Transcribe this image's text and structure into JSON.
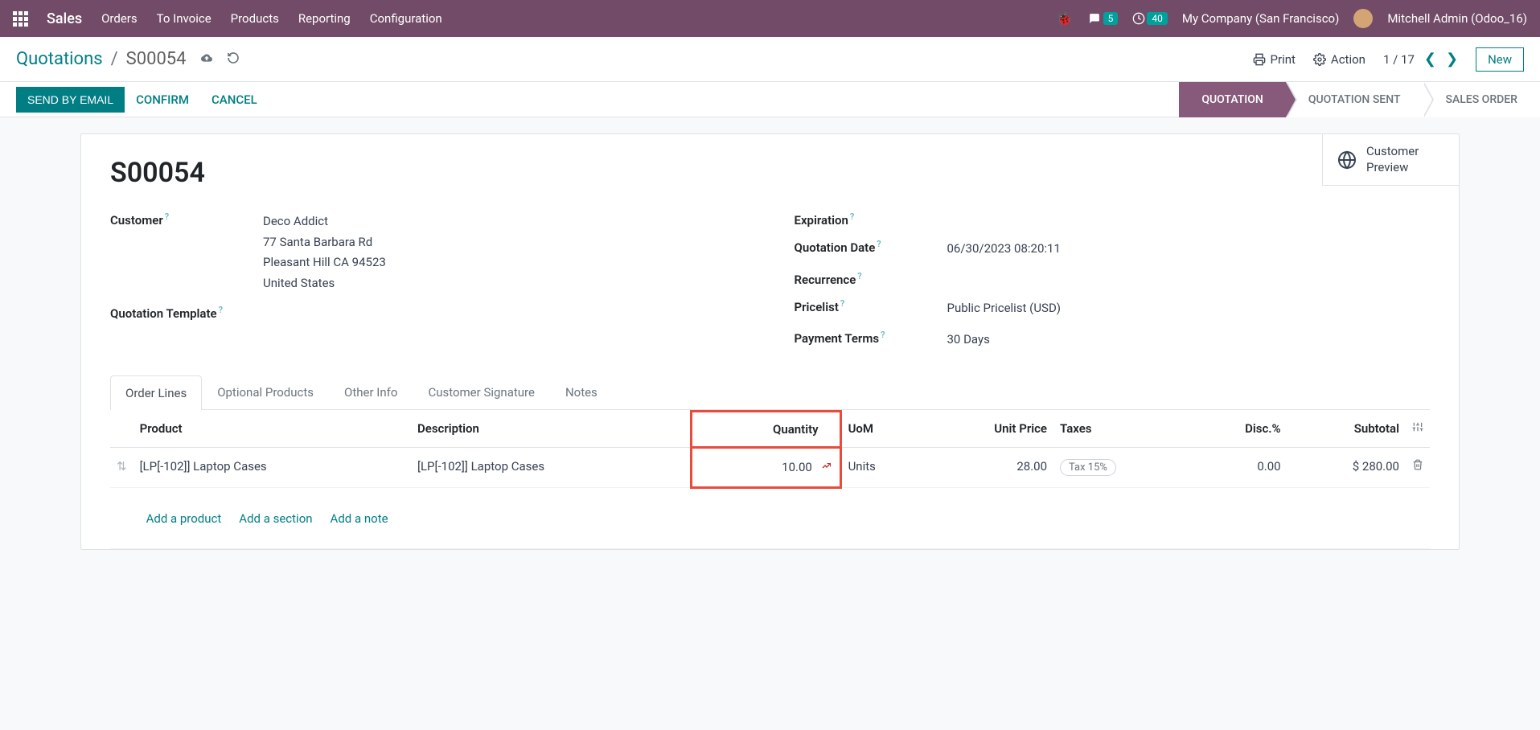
{
  "topnav": {
    "brand": "Sales",
    "items": [
      "Orders",
      "To Invoice",
      "Products",
      "Reporting",
      "Configuration"
    ],
    "msg_count": "5",
    "activity_count": "40",
    "company": "My Company (San Francisco)",
    "user": "Mitchell Admin (Odoo_16)"
  },
  "breadcrumb": {
    "root": "Quotations",
    "current": "S00054"
  },
  "controls": {
    "print": "Print",
    "action": "Action",
    "pager": "1 / 17",
    "new": "New"
  },
  "statusbar": {
    "send": "SEND BY EMAIL",
    "confirm": "CONFIRM",
    "cancel": "CANCEL",
    "steps": [
      "QUOTATION",
      "QUOTATION SENT",
      "SALES ORDER"
    ]
  },
  "statbutton": {
    "line1": "Customer",
    "line2": "Preview"
  },
  "record": {
    "title": "S00054",
    "labels": {
      "customer": "Customer",
      "template": "Quotation Template",
      "expiration": "Expiration",
      "quotation_date": "Quotation Date",
      "recurrence": "Recurrence",
      "pricelist": "Pricelist",
      "payment_terms": "Payment Terms"
    },
    "customer_name": "Deco Addict",
    "customer_addr1": "77 Santa Barbara Rd",
    "customer_addr2": "Pleasant Hill CA 94523",
    "customer_country": "United States",
    "quotation_date": "06/30/2023 08:20:11",
    "pricelist": "Public Pricelist (USD)",
    "payment_terms": "30 Days"
  },
  "tabs": [
    "Order Lines",
    "Optional Products",
    "Other Info",
    "Customer Signature",
    "Notes"
  ],
  "table": {
    "headers": {
      "product": "Product",
      "description": "Description",
      "quantity": "Quantity",
      "uom": "UoM",
      "unit_price": "Unit Price",
      "taxes": "Taxes",
      "disc": "Disc.%",
      "subtotal": "Subtotal"
    },
    "rows": [
      {
        "product": "[LP[-102]] Laptop Cases",
        "description": "[LP[-102]] Laptop Cases",
        "quantity": "10.00",
        "uom": "Units",
        "unit_price": "28.00",
        "tax": "Tax 15%",
        "disc": "0.00",
        "subtotal": "$ 280.00"
      }
    ],
    "footer": {
      "add_product": "Add a product",
      "add_section": "Add a section",
      "add_note": "Add a note"
    }
  }
}
